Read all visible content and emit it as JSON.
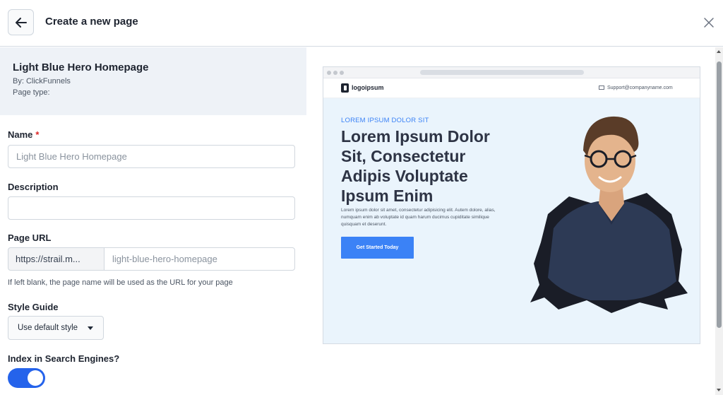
{
  "header": {
    "title": "Create a new page"
  },
  "template": {
    "name": "Light Blue Hero Homepage",
    "by": "By: ClickFunnels",
    "page_type": "Page type:"
  },
  "form": {
    "name_label": "Name",
    "name_required_mark": "*",
    "name_placeholder": "Light Blue Hero Homepage",
    "description_label": "Description",
    "description_value": "",
    "url_label": "Page URL",
    "url_prefix": "https://strail.m...",
    "url_placeholder": "light-blue-hero-homepage",
    "url_hint": "If left blank, the page name will be used as the URL for your page",
    "style_label": "Style Guide",
    "style_value": "Use default style",
    "index_label": "Index in Search Engines?",
    "index_enabled": true
  },
  "preview": {
    "logo_text": "logoipsum",
    "support_email": "Support@companyname.com",
    "eyebrow": "LOREM IPSUM DOLOR SIT",
    "headline": "Lorem Ipsum Dolor Sit, Consectetur Adipis Voluptate Ipsum Enim",
    "body": "Lorem ipsum dolor sit amet, consectetur adipisicing elit. Autem dolore, alias, numquam enim ab voluptate id quam harum ducimus cupiditate similique quisquam et deserunt.",
    "cta": "Get Started Today"
  },
  "colors": {
    "accent": "#2563eb",
    "hero_bg": "#eaf4fc",
    "required": "#dc2626"
  }
}
